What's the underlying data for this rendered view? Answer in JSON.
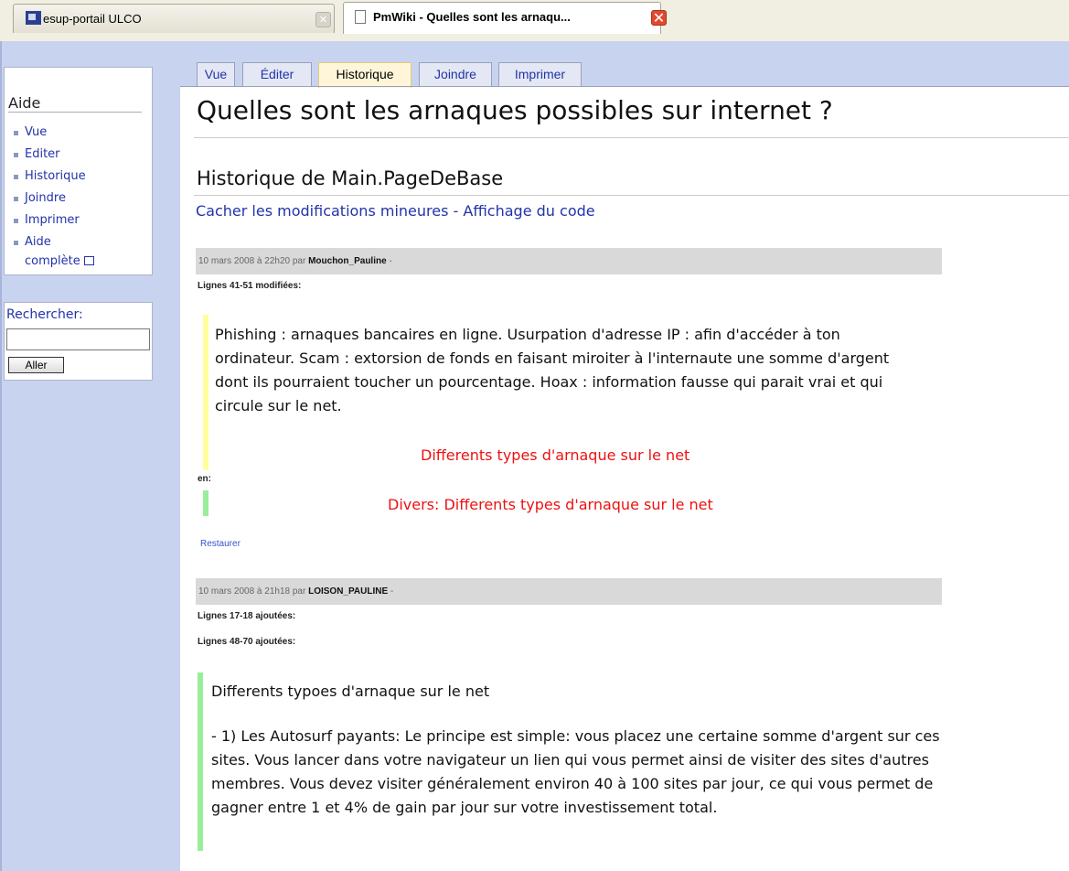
{
  "browser": {
    "tabs": [
      {
        "title": "esup-portail ULCO",
        "active": false
      },
      {
        "title": "PmWiki - Quelles sont les arnaqu...",
        "active": true
      }
    ]
  },
  "sidebar": {
    "title": "Aide",
    "items": [
      "Vue",
      "Editer",
      "Historique",
      "Joindre",
      "Imprimer",
      "Aide",
      "complète"
    ],
    "search_label": "Rechercher:",
    "search_value": "",
    "search_button": "Aller"
  },
  "wiki_tabs": [
    "Vue",
    "Éditer",
    "Historique",
    "Joindre",
    "Imprimer"
  ],
  "active_tab": "Historique",
  "page": {
    "title": "Quelles sont les arnaques possibles sur internet ?",
    "history_title": "Historique de Main.PageDeBase",
    "link_hide": "Cacher les modifications mineures",
    "link_sep": "-",
    "link_source": "Affichage du code"
  },
  "entries": [
    {
      "date": "10 mars 2008 à 22h20 par",
      "author": "Mouchon_Pauline",
      "dash": "-",
      "change1": "Lignes 41-51 modifiées:",
      "old_text": "Phishing : arnaques bancaires en ligne. Usurpation d'adresse IP : afin d'accéder à ton ordinateur. Scam : extorsion de fonds en faisant miroiter à l'internaute une somme d'argent dont ils pourraient toucher un pourcentage. Hoax : information fausse qui parait vrai et qui circule sur le net.",
      "old_heading": "Differents types d'arnaque sur le net",
      "en_label": "en:",
      "new_heading": "Divers: Differents types d'arnaque sur le net",
      "restore": "Restaurer"
    },
    {
      "date": "10 mars 2008 à 21h18 par",
      "author": "LOISON_PAULINE",
      "dash": "-",
      "change1": "Lignes 17-18 ajoutées:",
      "change2": "Lignes 48-70 ajoutées:",
      "added_heading": "Differents typoes d'arnaque sur le net",
      "added_text": "- 1) Les Autosurf payants: Le principe est simple: vous placez une certaine somme d'argent sur ces sites. Vous lancer dans votre navigateur un lien qui vous permet ainsi de visiter des sites d'autres membres. Vous devez visiter généralement environ 40 à 100 sites par jour, ce qui vous permet de gagner entre 1 et 4% de gain par jour sur votre investissement total."
    }
  ],
  "colors": {
    "sidebar_bg": "#c8d3f0",
    "link": "#2233aa",
    "changed_bar": "#ffff9e",
    "added_bar": "#99ee99",
    "diff_red": "#ee1111",
    "active_tab_bg": "#fff6d9"
  }
}
